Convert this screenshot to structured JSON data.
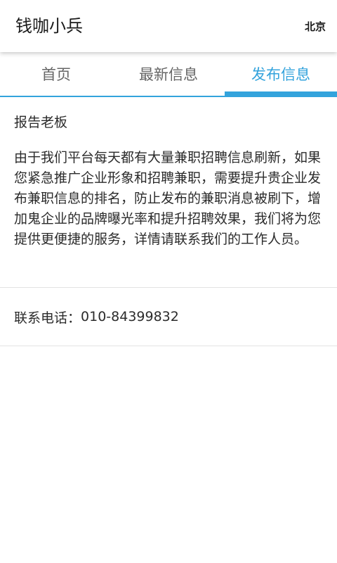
{
  "appbar": {
    "title": "钱咖小兵",
    "city": "北京"
  },
  "tabs": [
    {
      "label": "首页",
      "active": false
    },
    {
      "label": "最新信息",
      "active": false
    },
    {
      "label": "发布信息",
      "active": true
    }
  ],
  "notice": {
    "heading": "报告老板",
    "body": "由于我们平台每天都有大量兼职招聘信息刷新，如果您紧急推广企业形象和招聘兼职，需要提升贵企业发布兼职信息的排名，防止发布的兼职消息被刷下，增加鬼企业的品牌曝光率和提升招聘效果，我们将为您提供更便捷的服务，详情请联系我们的工作人员。"
  },
  "contact": {
    "label": "联系电话：",
    "phone": "010-84399832"
  },
  "colors": {
    "accent": "#33a3dc",
    "text": "#2b2b2b",
    "inactive_tab": "#666666",
    "divider": "#e3e3e3"
  }
}
